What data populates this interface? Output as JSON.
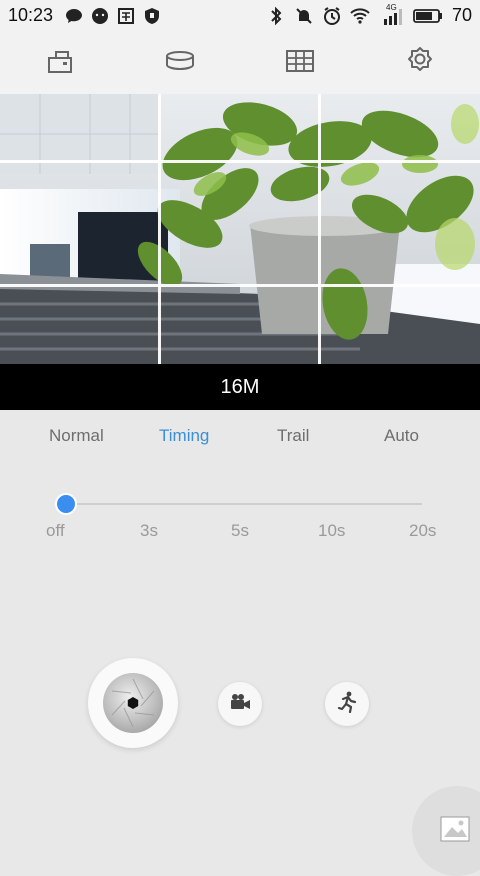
{
  "status_bar": {
    "time": "10:23",
    "left_icons": [
      "chat-bubble-icon",
      "wechat-icon",
      "app-icon",
      "shield-icon"
    ],
    "right_icons": [
      "bluetooth-icon",
      "mute-icon",
      "alarm-icon",
      "wifi-icon",
      "signal-icon",
      "battery-icon"
    ],
    "network": "4G",
    "battery": "70"
  },
  "toolbar": {
    "buttons": [
      "tilt-icon",
      "panorama-icon",
      "grid-icon",
      "settings-icon"
    ]
  },
  "preview": {
    "resolution": "16M"
  },
  "modes": {
    "items": [
      "Normal",
      "Timing",
      "Trail",
      "Auto"
    ],
    "active": "Timing"
  },
  "timer": {
    "options": [
      "off",
      "3s",
      "5s",
      "10s",
      "20s"
    ],
    "selected": "off"
  },
  "controls": {
    "shutter": "shutter-icon",
    "video": "video-camera-icon",
    "motion": "running-person-icon",
    "gallery": "gallery-icon"
  },
  "colors": {
    "accent": "#3a8fd6",
    "knob": "#3a8ef0"
  }
}
